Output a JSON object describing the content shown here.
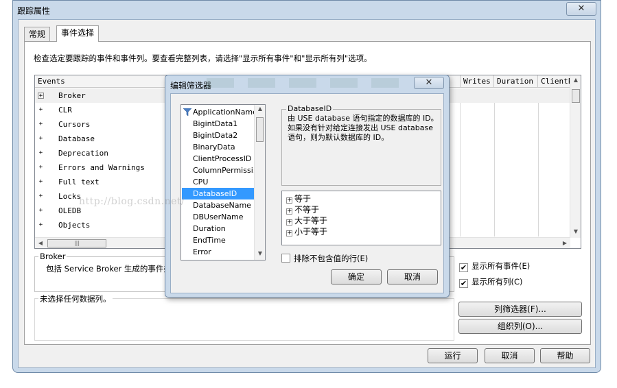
{
  "window": {
    "title": "跟踪属性",
    "close_glyph": "✕"
  },
  "tabs": [
    {
      "label": "常规"
    },
    {
      "label": "事件选择"
    }
  ],
  "instruction": "检查选定要跟踪的事件和事件列。要查看完整列表，请选择\"显示所有事件\"和\"显示所有列\"选项。",
  "grid": {
    "columns": [
      "Events",
      "Writes",
      "Duration",
      "ClientP"
    ],
    "rows": [
      "Broker",
      "CLR",
      "Cursors",
      "Database",
      "Deprecation",
      "Errors and Warnings",
      "Full text",
      "Locks",
      "OLEDB",
      "Objects"
    ],
    "expand_glyph": "+"
  },
  "broker_group": {
    "title": "Broker",
    "text": "包括 Service Broker 生成的事件类"
  },
  "columns_group": {
    "title": "未选择任何数据列。"
  },
  "checkboxes": {
    "show_all_events": {
      "label": "显示所有事件(E)",
      "checked": true
    },
    "show_all_columns": {
      "label": "显示所有列(C)",
      "checked": true
    }
  },
  "buttons": {
    "column_filter": "列筛选器(F)...",
    "organize_columns": "组织列(O)...",
    "run": "运行",
    "cancel": "取消",
    "help": "帮助"
  },
  "dialog": {
    "title": "编辑筛选器",
    "close_glyph": "✕",
    "list_items": [
      "ApplicationName",
      "BigintData1",
      "BigintData2",
      "BinaryData",
      "ClientProcessID",
      "ColumnPermissi...",
      "CPU",
      "DatabaseID",
      "DatabaseName",
      "DBUserName",
      "Duration",
      "EndTime",
      "Error"
    ],
    "selected_item": "DatabaseID",
    "description_title": "DatabaseID",
    "description_text": "由 USE database 语句指定的数据库的 ID。如果没有针对给定连接发出 USE database 语句，则为默认数据库的 ID。",
    "operators": [
      "等于",
      "不等于",
      "大于等于",
      "小于等于"
    ],
    "exclude_label": "排除不包含值的行(E)",
    "exclude_checked": false,
    "ok": "确定",
    "cancel": "取消"
  },
  "watermark": "http://blog.csdn.net/",
  "colors": {
    "window_frame": "#c9d9ea",
    "selection": "#3399ff"
  }
}
